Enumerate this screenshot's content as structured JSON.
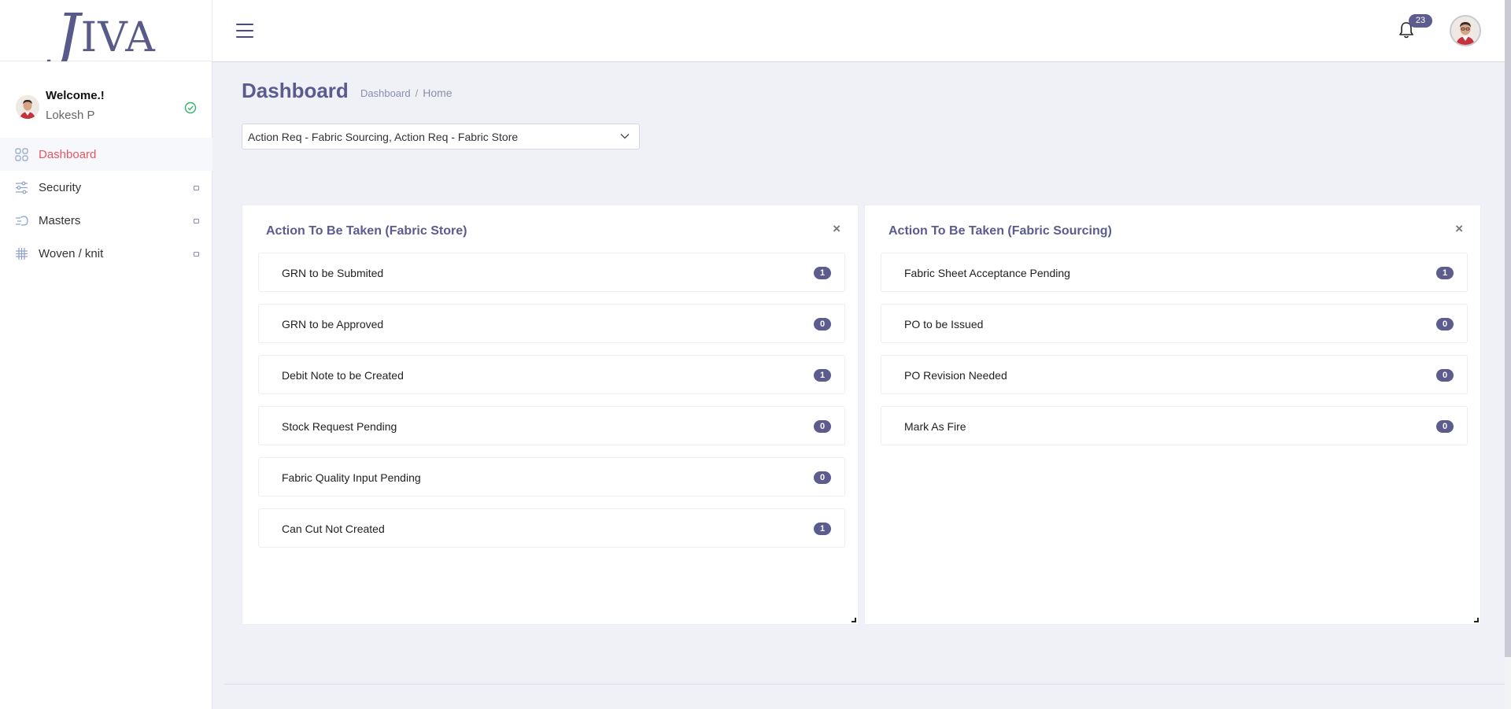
{
  "app": {
    "logo": "JIVA",
    "notification_count": "23"
  },
  "user": {
    "welcome": "Welcome.!",
    "name": "Lokesh P"
  },
  "sidebar": {
    "items": [
      {
        "label": "Dashboard",
        "icon": "grid-icon",
        "active": true
      },
      {
        "label": "Security",
        "icon": "sliders-icon",
        "active": false
      },
      {
        "label": "Masters",
        "icon": "speed-icon",
        "active": false
      },
      {
        "label": "Woven / knit",
        "icon": "hash-icon",
        "active": false
      }
    ]
  },
  "page": {
    "title": "Dashboard",
    "breadcrumb": [
      "Dashboard",
      "Home"
    ]
  },
  "filter": {
    "value": "Action Req - Fabric Sourcing, Action Req - Fabric Store"
  },
  "cards": [
    {
      "title": "Action To Be Taken (Fabric Store)",
      "close": "×",
      "tasks": [
        {
          "label": "GRN to be Submited",
          "count": "1"
        },
        {
          "label": "GRN to be Approved",
          "count": "0"
        },
        {
          "label": "Debit Note to be Created",
          "count": "1"
        },
        {
          "label": "Stock Request Pending",
          "count": "0"
        },
        {
          "label": "Fabric Quality Input Pending",
          "count": "0"
        },
        {
          "label": "Can Cut Not Created",
          "count": "1"
        }
      ]
    },
    {
      "title": "Action To Be Taken (Fabric Sourcing)",
      "close": "×",
      "tasks": [
        {
          "label": "Fabric Sheet Acceptance Pending",
          "count": "1"
        },
        {
          "label": "PO to be Issued",
          "count": "0"
        },
        {
          "label": "PO Revision Needed",
          "count": "0"
        },
        {
          "label": "Mark As Fire",
          "count": "0"
        }
      ]
    }
  ],
  "colors": {
    "accent": "#5c5c8e",
    "active": "#e8555f",
    "online": "#2fb36b"
  }
}
